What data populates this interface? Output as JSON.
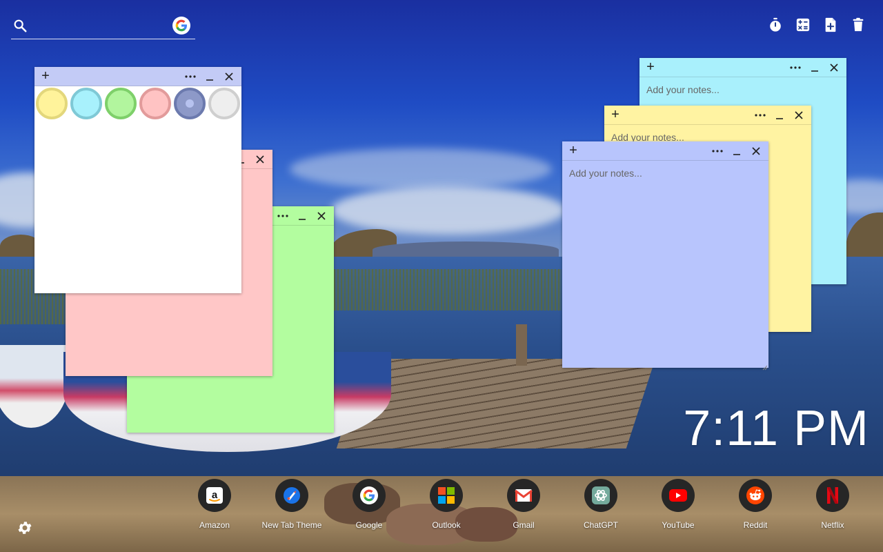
{
  "search": {
    "placeholder": ""
  },
  "toolbar": {
    "items": [
      {
        "name": "timer",
        "icon": "timer-icon"
      },
      {
        "name": "calculator",
        "icon": "calculator-icon"
      },
      {
        "name": "new-note",
        "icon": "note-add-icon"
      },
      {
        "name": "delete",
        "icon": "trash-icon"
      }
    ]
  },
  "notes": [
    {
      "id": "white",
      "color": "#ffffff",
      "value": "",
      "placeholder": ""
    },
    {
      "id": "pink",
      "color": "#ffc7c7",
      "value": "",
      "placeholder": ""
    },
    {
      "id": "green",
      "color": "#b3fd9f",
      "value": "",
      "placeholder": ""
    },
    {
      "id": "cyan",
      "color": "#a9f0fc",
      "value": "",
      "placeholder": "Add your notes..."
    },
    {
      "id": "yellow",
      "color": "#fff3a2",
      "value": "",
      "placeholder": "Add your notes..."
    },
    {
      "id": "blue",
      "color": "#b8c5fd",
      "value": "",
      "placeholder": "Add your notes..."
    }
  ],
  "swatches": [
    {
      "fill": "#fff39b",
      "ring": "#e3d77c"
    },
    {
      "fill": "#a8f1fc",
      "ring": "#7fc9d6"
    },
    {
      "fill": "#b2f59e",
      "ring": "#7ed06a"
    },
    {
      "fill": "#ffc3c3",
      "ring": "#e29b9b"
    },
    {
      "fill": "#8d99c8",
      "ring": "#6c7aae"
    },
    {
      "fill": "#eeeeee",
      "ring": "#cfcfcf"
    }
  ],
  "clock": {
    "time": "7:11 PM"
  },
  "shortcuts": [
    {
      "label": "Amazon",
      "icon": "amazon-icon"
    },
    {
      "label": "New Tab Theme",
      "icon": "new-tab-theme-icon"
    },
    {
      "label": "Google",
      "icon": "google-icon"
    },
    {
      "label": "Outlook",
      "icon": "outlook-icon"
    },
    {
      "label": "Gmail",
      "icon": "gmail-icon"
    },
    {
      "label": "ChatGPT",
      "icon": "chatgpt-icon"
    },
    {
      "label": "YouTube",
      "icon": "youtube-icon"
    },
    {
      "label": "Reddit",
      "icon": "reddit-icon"
    },
    {
      "label": "Netflix",
      "icon": "netflix-icon"
    }
  ]
}
